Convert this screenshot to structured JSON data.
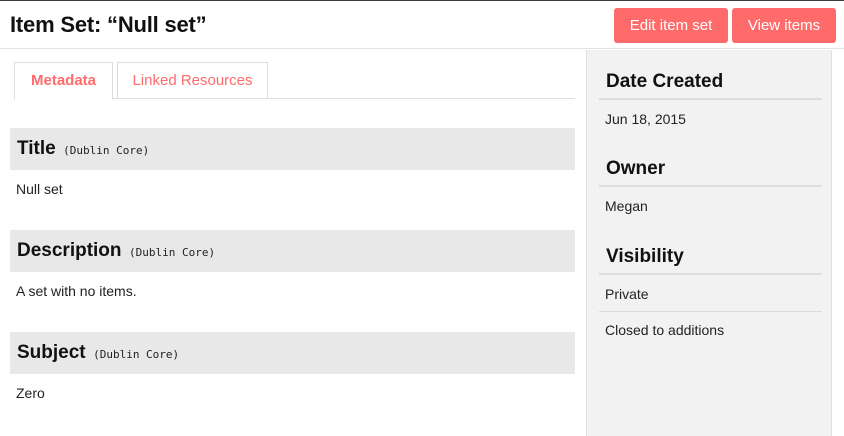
{
  "header": {
    "title": "Item Set: “Null set”",
    "edit_button": "Edit item set",
    "view_button": "View items"
  },
  "tabs": [
    {
      "label": "Metadata",
      "active": true
    },
    {
      "label": "Linked Resources",
      "active": false
    }
  ],
  "properties": [
    {
      "label": "Title",
      "vocab": "(Dublin Core)",
      "value": "Null set"
    },
    {
      "label": "Description",
      "vocab": "(Dublin Core)",
      "value": "A set with no items."
    },
    {
      "label": "Subject",
      "vocab": "(Dublin Core)",
      "value": "Zero"
    }
  ],
  "sidebar": {
    "date_created": {
      "heading": "Date Created",
      "value": "Jun 18, 2015"
    },
    "owner": {
      "heading": "Owner",
      "value": "Megan"
    },
    "visibility": {
      "heading": "Visibility",
      "value": "Private",
      "extra": "Closed to additions"
    }
  },
  "colors": {
    "accent": "#ff6b6b",
    "sidebar_bg": "#f2f2f2",
    "property_header_bg": "#e8e8e8"
  }
}
